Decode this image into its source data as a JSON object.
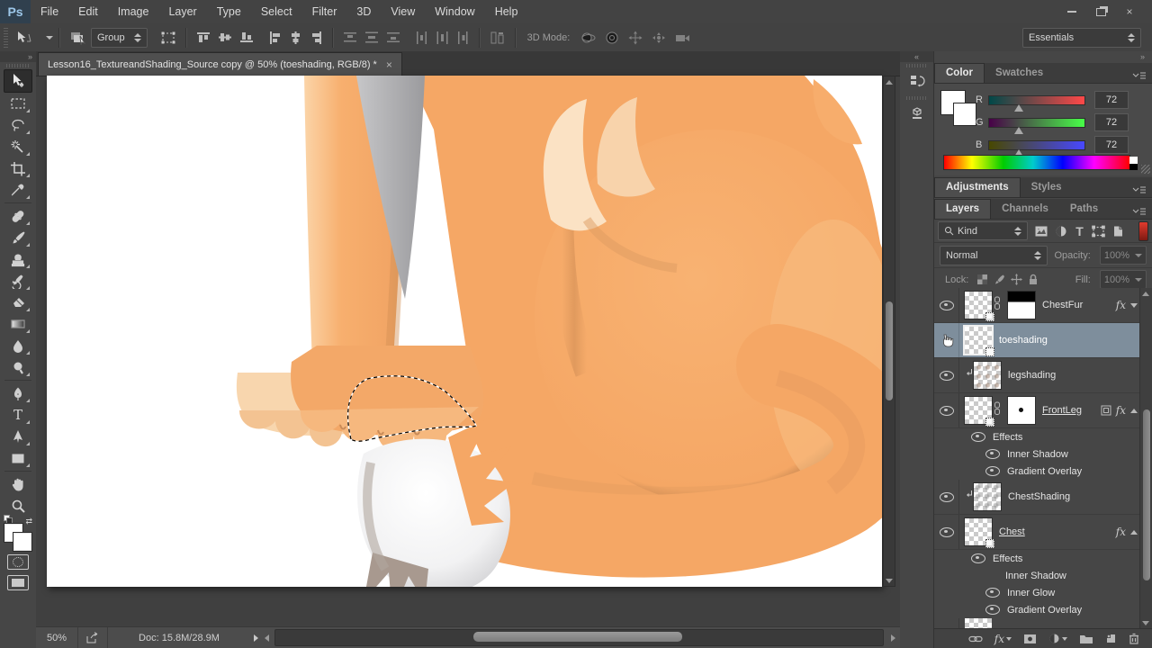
{
  "menu": {
    "logo": "Ps",
    "items": [
      "File",
      "Edit",
      "Image",
      "Layer",
      "Type",
      "Select",
      "Filter",
      "3D",
      "View",
      "Window",
      "Help"
    ]
  },
  "window_controls": {
    "minimize": "minimize",
    "restore": "restore",
    "close": "×"
  },
  "options": {
    "group": "Group",
    "mode_label": "3D Mode:",
    "workspace": "Essentials"
  },
  "doc_tab": {
    "title": "Lesson16_TextureandShading_Source copy @ 50% (toeshading, RGB/8) *",
    "close": "×"
  },
  "status": {
    "zoom": "50%",
    "doc": "Doc: 15.8M/28.9M"
  },
  "color_panel": {
    "tab_color": "Color",
    "tab_swatches": "Swatches",
    "channels": {
      "r": {
        "label": "R",
        "value": "72"
      },
      "g": {
        "label": "G",
        "value": "72"
      },
      "b": {
        "label": "B",
        "value": "72"
      }
    }
  },
  "adjustments_panel": {
    "tab_adjustments": "Adjustments",
    "tab_styles": "Styles"
  },
  "layers_panel": {
    "tab_layers": "Layers",
    "tab_channels": "Channels",
    "tab_paths": "Paths",
    "kind": "Kind",
    "blend_mode": "Normal",
    "opacity_label": "Opacity:",
    "opacity_value": "100%",
    "lock_label": "Lock:",
    "fill_label": "Fill:",
    "fill_value": "100%",
    "fx_label": "fx",
    "rows": {
      "r0": {
        "name": "ChestFur"
      },
      "r1": {
        "name": "toeshading"
      },
      "r2": {
        "name": "legshading"
      },
      "r3": {
        "name": "FrontLeg"
      },
      "r4": {
        "label": "Effects"
      },
      "r5": {
        "label": "Inner Shadow"
      },
      "r6": {
        "label": "Gradient Overlay"
      },
      "r7": {
        "name": "ChestShading"
      },
      "r8": {
        "name": "Chest"
      },
      "r9": {
        "label": "Effects"
      },
      "r10": {
        "label": "Inner Shadow"
      },
      "r11": {
        "label": "Inner Glow"
      },
      "r12": {
        "label": "Gradient Overlay"
      }
    }
  },
  "tools": [
    "move",
    "rectangular-marquee",
    "lasso",
    "magic-wand",
    "crop",
    "eyedropper",
    "spot-healing-brush",
    "brush",
    "clone-stamp",
    "history-brush",
    "eraser",
    "gradient",
    "blur",
    "dodge",
    "pen",
    "type",
    "path-selection",
    "rectangle",
    "hand",
    "zoom"
  ],
  "theme": {
    "selected_layer": "#7e8e9c",
    "fox_orange": "#f5a765",
    "panel_bg": "#464646",
    "canvas_bg": "#ffffff",
    "toggle_red": "#d93a2c"
  }
}
